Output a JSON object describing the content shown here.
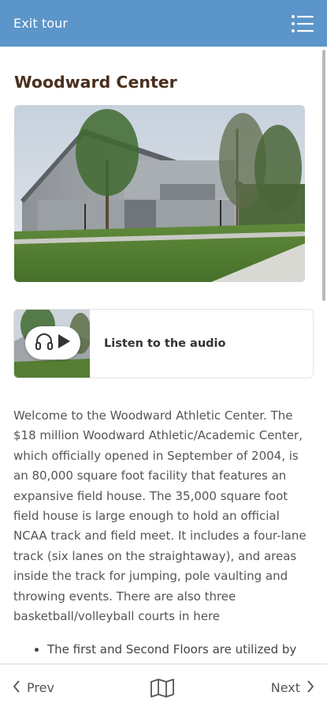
{
  "header": {
    "exit_label": "Exit tour",
    "menu_icon": "menu-list-icon"
  },
  "stop": {
    "title": "Woodward Center",
    "audio_label": "Listen to the audio",
    "description": "Welcome to the Woodward Athletic Center. The $18 million Woodward Athletic/Academic Center, which officially opened in September of 2004, is an 80,000 square foot facility that features an expansive field house. The 35,000 square foot field house is large enough to hold an official NCAA track and field meet. It includes a four-lane track (six lanes on the straightaway), and areas inside the track for jumping, pole vaulting and throwing events. There are also three basketball/volleyball courts in here",
    "bullets": [
      "The first and Second Floors are utilized by"
    ]
  },
  "footer": {
    "prev_label": "Prev",
    "next_label": "Next",
    "map_icon": "map-icon"
  },
  "colors": {
    "header_bg": "#5b95c9",
    "title_color": "#4a2f1e"
  }
}
